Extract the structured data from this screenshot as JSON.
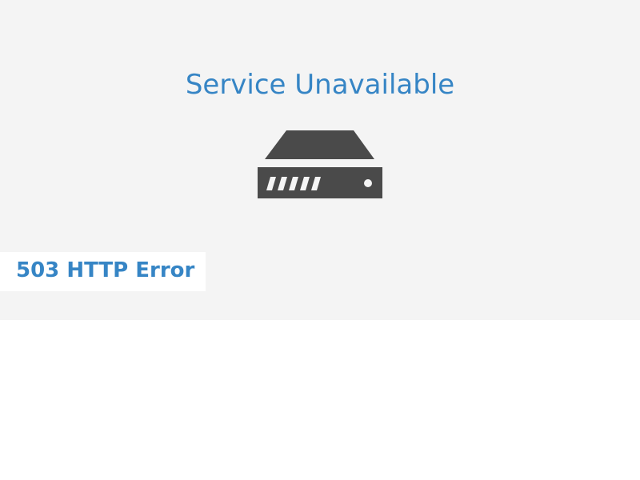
{
  "page": {
    "title": "Service Unavailable",
    "icon": "server-icon",
    "error_code_label": "503 HTTP Error"
  },
  "colors": {
    "accent": "#3685c5",
    "icon": "#4a4a4a",
    "panel": "#f4f4f4"
  }
}
